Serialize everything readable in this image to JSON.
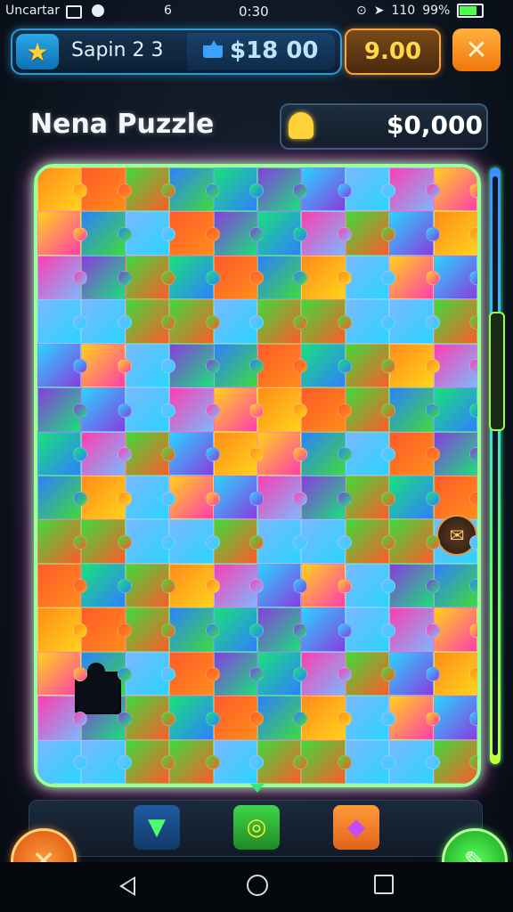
{
  "status_bar": {
    "carrier": "Uncartar",
    "notification_count": "6",
    "time": "0:30",
    "network": "110",
    "battery": "99%"
  },
  "top_bar": {
    "stage_label": "Sapin 2 3",
    "coins": "$18 00",
    "timer": "9.00",
    "close_glyph": "✕",
    "star_glyph": "★"
  },
  "header": {
    "title": "Nena Puzzle",
    "score": "$0,000"
  },
  "board": {
    "rows": 14,
    "cols": 10,
    "palette": [
      "#ff8c1a",
      "#2f7fff",
      "#2ad4ff",
      "#ffd21a",
      "#3ddb3a",
      "#8a3be0",
      "#ff3db0",
      "#ff5a2a",
      "#19e07a",
      "#7ab8ff"
    ],
    "hint_glyph": "✉"
  },
  "tools": [
    {
      "name": "drop-tool",
      "glyph": "▼"
    },
    {
      "name": "target-tool",
      "glyph": "◎"
    },
    {
      "name": "gem-tool",
      "glyph": "◆"
    }
  ],
  "round_buttons": {
    "left_glyph": "✕",
    "right_glyph": "✎"
  }
}
